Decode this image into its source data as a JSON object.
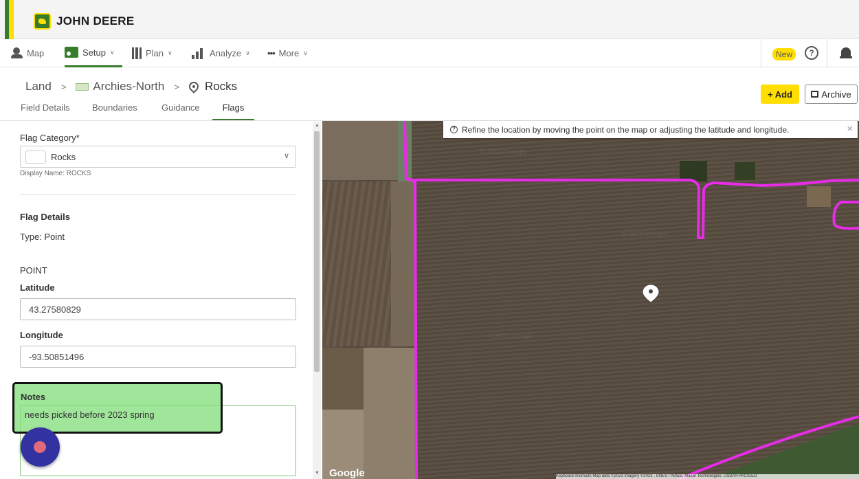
{
  "brand": {
    "name": "JOHN DEERE",
    "colors": {
      "green": "#367c2b",
      "yellow": "#ffde00",
      "boundary": "#e62ce6"
    }
  },
  "nav": {
    "items": [
      {
        "label": "Map",
        "icon": "map-pin-person-icon"
      },
      {
        "label": "Setup",
        "icon": "setup-icon",
        "active": true
      },
      {
        "label": "Plan",
        "icon": "plan-icon"
      },
      {
        "label": "Analyze",
        "icon": "analyze-chart-icon"
      },
      {
        "label": "More",
        "icon": "more-dots-icon"
      }
    ],
    "new_badge": "New",
    "help_icon": "?"
  },
  "breadcrumb": {
    "root": "Land",
    "field": "Archies-North",
    "current": "Rocks"
  },
  "actions": {
    "add": "+ Add",
    "archive": "Archive"
  },
  "tabs": [
    "Field Details",
    "Boundaries",
    "Guidance",
    "Flags"
  ],
  "form": {
    "category_label": "Flag Category*",
    "category_value": "Rocks",
    "display_name": "Display Name: ROCKS",
    "details_title": "Flag Details",
    "type_text": "Type: Point",
    "point_heading": "POINT",
    "latitude_label": "Latitude",
    "latitude_value": "43.27580829",
    "longitude_label": "Longitude",
    "longitude_value": "-93.50851496",
    "notes_label": "Notes",
    "notes_value": "needs picked before 2023 spring"
  },
  "map": {
    "tip": "Refine the location by moving the point on the map or adjusting the latitude and longitude.",
    "google": "Google",
    "attribution": "Keyboard shortcuts   Map data ©2023 Imagery ©2023 , CNES / Airbus, Maxar Technologies, USDA/FPAC/GEO"
  }
}
